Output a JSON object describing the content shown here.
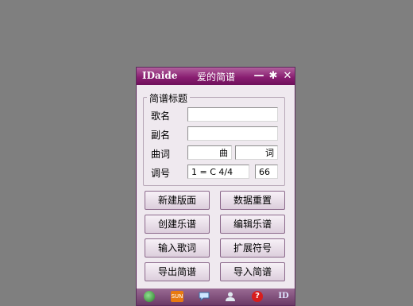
{
  "titlebar": {
    "logo": "IDaide",
    "title": "爱的简谱",
    "minimize_glyph": "—",
    "settings_glyph": "✱",
    "close_glyph": "✕"
  },
  "form": {
    "group_title": "简谱标题",
    "song_label": "歌名",
    "song_value": "",
    "subtitle_label": "副名",
    "subtitle_value": "",
    "composer_label": "曲词",
    "composer_value": "曲",
    "lyricist_value": "词",
    "key_label": "调号",
    "key_value": "1 = C 4/4",
    "tempo_value": "66"
  },
  "buttons": {
    "new_layout": "新建版面",
    "reset_data": "数据重置",
    "create_score": "创建乐谱",
    "edit_score": "编辑乐谱",
    "input_lyrics": "输入歌词",
    "extended_symbols": "扩展符号",
    "export_score": "导出简谱",
    "import_score": "导入简谱"
  },
  "statusbar": {
    "sun_label": "SUN",
    "help_glyph": "?",
    "id_label": "ID"
  },
  "colors": {
    "title_bar": "#8a1f72",
    "window_bg": "#efe9ef",
    "status_bar": "#7a4a74",
    "desktop": "#7f7f7f"
  }
}
